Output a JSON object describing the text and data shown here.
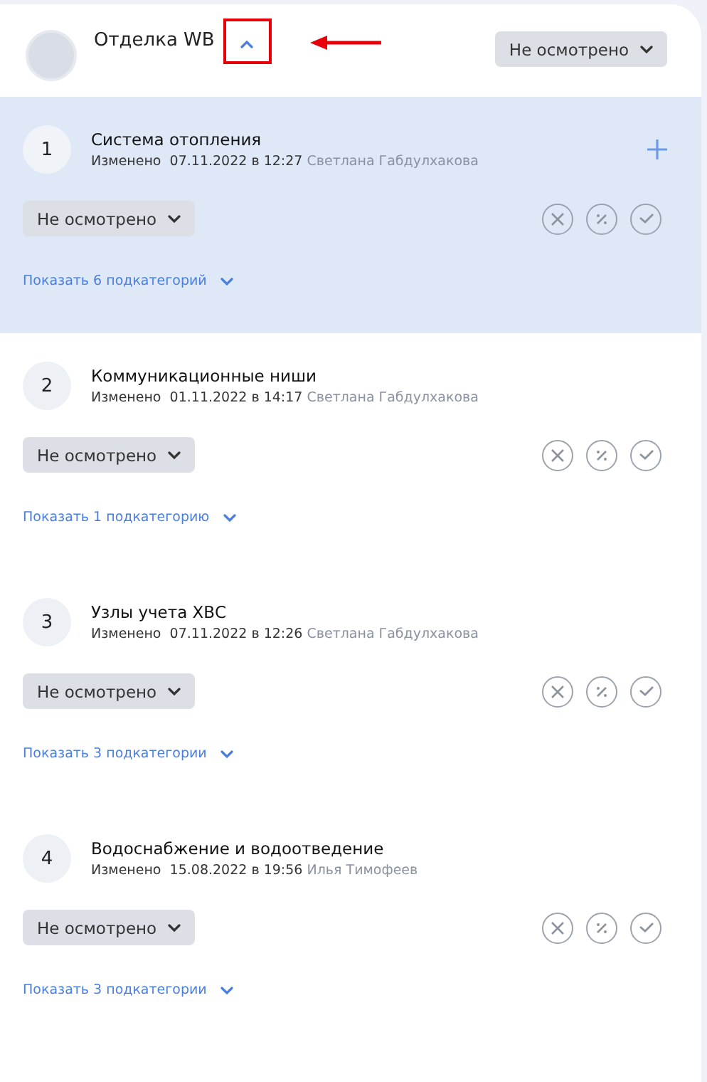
{
  "header": {
    "title": "Отделка WB",
    "expanded": true,
    "status": "Не осмотрено"
  },
  "items": [
    {
      "number": "1",
      "title": "Система отопления",
      "modified": "Изменено",
      "date": "07.11.2022 в 12:27",
      "author": "Светлана Габдулхакова",
      "status": "Не осмотрено",
      "link": "Показать 6 подкатегорий",
      "selected": true
    },
    {
      "number": "2",
      "title": "Коммуникационные ниши",
      "modified": "Изменено",
      "date": "01.11.2022 в 14:17",
      "author": "Светлана Габдулхакова",
      "status": "Не осмотрено",
      "link": "Показать 1 подкатегорию",
      "selected": false
    },
    {
      "number": "3",
      "title": "Узлы учета ХВС",
      "modified": "Изменено",
      "date": "07.11.2022 в 12:26",
      "author": "Светлана Габдулхакова",
      "status": "Не осмотрено",
      "link": "Показать 3 подкатегории",
      "selected": false
    },
    {
      "number": "4",
      "title": "Водоснабжение и водоотведение",
      "modified": "Изменено",
      "date": "15.08.2022 в 19:56",
      "author": "Илья Тимофеев",
      "status": "Не осмотрено",
      "link": "Показать 3 подкатегории",
      "selected": false
    }
  ]
}
